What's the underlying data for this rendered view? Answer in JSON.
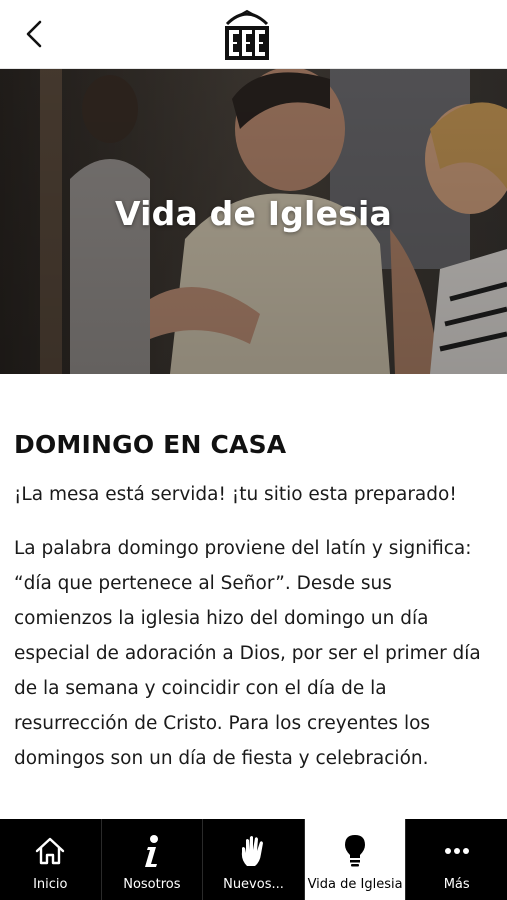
{
  "header": {
    "back_icon": "chevron-left-icon",
    "logo_icon": "church-logo-icon"
  },
  "hero": {
    "title": "Vida de Iglesia"
  },
  "main": {
    "section_title": "DOMINGO EN CASA",
    "tagline": "¡La mesa está servida! ¡tu sitio esta preparado!",
    "body": "La palabra domingo proviene del latín y significa: “día que pertenece al Señor”. Desde sus comienzos la iglesia hizo del domingo un día especial de adoración a Dios, por ser el primer día de la semana y coincidir con el día de la resurrección de Cristo. Para los creyentes los domingos son un día de fiesta y celebración."
  },
  "tabbar": {
    "active_index": 3,
    "items": [
      {
        "label": "Inicio",
        "icon": "home-icon"
      },
      {
        "label": "Nosotros",
        "icon": "info-icon"
      },
      {
        "label": "Nuevos...",
        "icon": "hand-icon"
      },
      {
        "label": "Vida de Iglesia",
        "icon": "lightbulb-icon"
      },
      {
        "label": "Más",
        "icon": "more-dots-icon"
      }
    ]
  }
}
